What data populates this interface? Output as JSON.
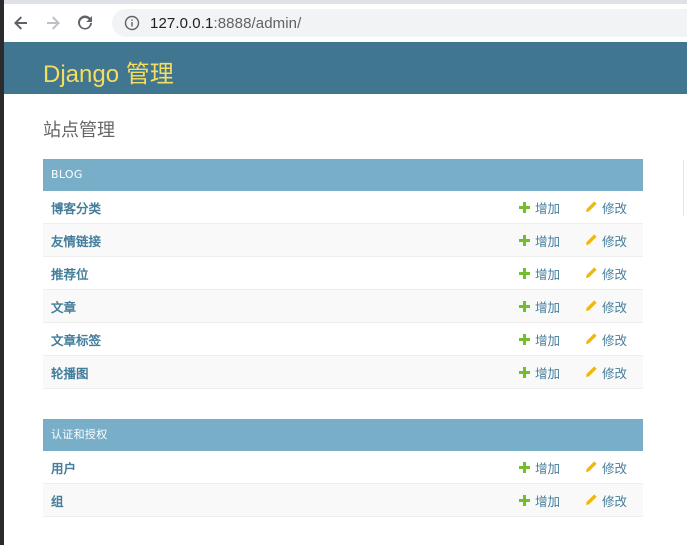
{
  "browser": {
    "url_host": "127.0.0.1",
    "url_rest": ":8888/admin/"
  },
  "header": {
    "branding": "Django 管理"
  },
  "page": {
    "title": "站点管理"
  },
  "actions": {
    "add_label": "增加",
    "change_label": "修改"
  },
  "modules": [
    {
      "caption": "BLOG",
      "models": [
        {
          "name": "博客分类"
        },
        {
          "name": "友情链接"
        },
        {
          "name": "推荐位"
        },
        {
          "name": "文章"
        },
        {
          "name": "文章标签"
        },
        {
          "name": "轮播图"
        }
      ]
    },
    {
      "caption": "认证和授权",
      "models": [
        {
          "name": "用户"
        },
        {
          "name": "组"
        }
      ]
    }
  ],
  "colors": {
    "header_bg": "#417690",
    "branding": "#f5dd5d",
    "caption_bg": "#79aec8",
    "link": "#447e9b",
    "add_icon": "#70bf2b",
    "change_icon": "#efb80b"
  }
}
